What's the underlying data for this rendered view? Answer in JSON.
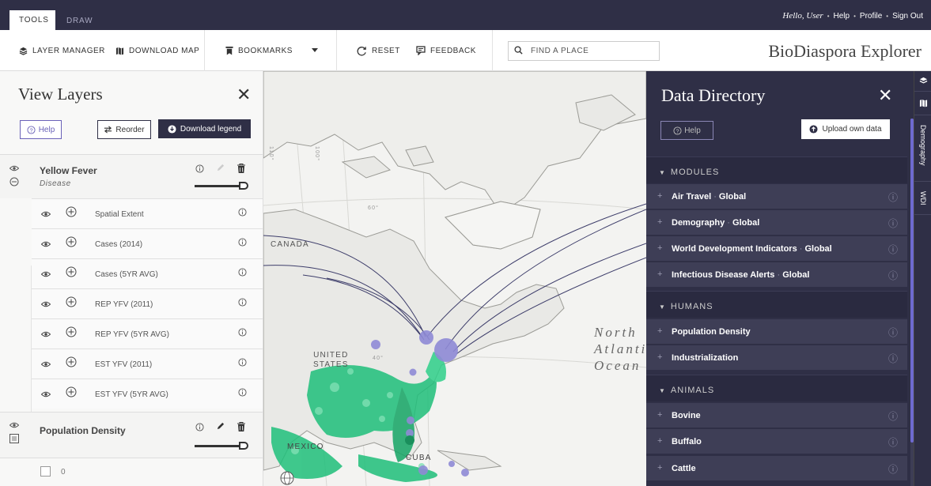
{
  "topbar": {
    "tabs": [
      {
        "label": "TOOLS"
      },
      {
        "label": "DRAW"
      }
    ],
    "greeting": "Hello, User",
    "links": [
      "Help",
      "Profile",
      "Sign Out"
    ]
  },
  "toolbar": {
    "layer_manager": "LAYER MANAGER",
    "download_map": "DOWNLOAD MAP",
    "bookmarks": "BOOKMARKS",
    "reset": "RESET",
    "feedback": "FEEDBACK",
    "search_placeholder": "FIND A PLACE",
    "brand": "BioDiaspora Explorer"
  },
  "view_layers": {
    "title": "View Layers",
    "help": "Help",
    "reorder": "Reorder",
    "download_legend": "Download legend",
    "layers": [
      {
        "title": "Yellow Fever",
        "subtitle": "Disease",
        "sublayers": [
          "Spatial Extent",
          "Cases (2014)",
          "Cases (5YR AVG)",
          "REP YFV (2011)",
          "REP YFV (5YR AVG)",
          "EST YFV (2011)",
          "EST YFV (5YR AVG)"
        ]
      },
      {
        "title": "Population Density"
      }
    ],
    "legend_value": "0"
  },
  "map": {
    "labels": {
      "canada": "CANADA",
      "us_line1": "UNITED",
      "us_line2": "STATES",
      "mexico": "MEXICO",
      "cuba": "CUBA",
      "ocean_1": "North",
      "ocean_2": "Atlantic",
      "ocean_3": "Ocean",
      "lat_60": "60°",
      "lat_40": "40°",
      "lon_110": "110°",
      "lon_100": "100°"
    }
  },
  "data_directory": {
    "title": "Data Directory",
    "help": "Help",
    "upload": "Upload own data",
    "sections": [
      {
        "title": "MODULES",
        "items": [
          {
            "name": "Air Travel",
            "scope": "Global"
          },
          {
            "name": "Demography",
            "scope": "Global"
          },
          {
            "name": "World Development Indicators",
            "scope": "Global"
          },
          {
            "name": "Infectious Disease Alerts",
            "scope": "Global"
          }
        ]
      },
      {
        "title": "HUMANS",
        "items": [
          {
            "name": "Population Density"
          },
          {
            "name": "Industrialization"
          }
        ]
      },
      {
        "title": "ANIMALS",
        "items": [
          {
            "name": "Bovine"
          },
          {
            "name": "Buffalo"
          },
          {
            "name": "Cattle"
          }
        ]
      }
    ]
  },
  "rail": {
    "items": [
      "Demography",
      "WDI"
    ]
  },
  "colors": {
    "navy": "#2f2f46",
    "accent": "#6a62b8",
    "bubble": "#8f8ad6",
    "density": "#1fbf7a"
  },
  "icons": [
    "layers-icon",
    "map-icon",
    "bookmark-icon",
    "chevron-down-icon",
    "reset-icon",
    "feedback-icon",
    "search-icon",
    "close-icon",
    "help-icon",
    "reorder-icon",
    "download-icon",
    "eye-icon",
    "collapse-icon",
    "add-icon",
    "info-icon",
    "pencil-icon",
    "trash-icon",
    "legend-icon",
    "upload-icon",
    "globe-icon"
  ]
}
